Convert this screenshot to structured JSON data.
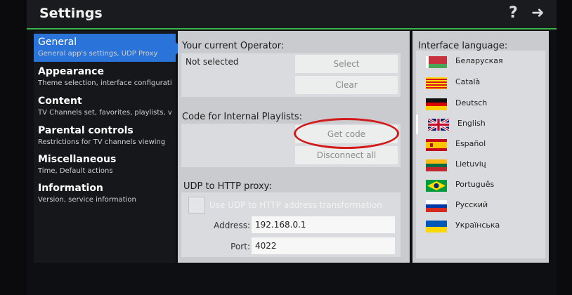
{
  "header": {
    "title": "Settings",
    "help_icon": "?",
    "forward_icon": "➜"
  },
  "sidebar": {
    "items": [
      {
        "label": "General",
        "sub": "General app's settings, UDP Proxy"
      },
      {
        "label": "Appearance",
        "sub": "Theme selection, interface configuration"
      },
      {
        "label": "Content",
        "sub": "TV Channels set, favorites, playlists, video"
      },
      {
        "label": "Parental controls",
        "sub": "Restrictions for TV channels viewing"
      },
      {
        "label": "Miscellaneous",
        "sub": "Time, Default actions"
      },
      {
        "label": "Information",
        "sub": "Version, service information"
      }
    ]
  },
  "operator": {
    "title": "Your current Operator:",
    "value": "Not selected",
    "select_label": "Select",
    "clear_label": "Clear"
  },
  "playlists": {
    "title": "Code for Internal Playlists:",
    "get_code_label": "Get code",
    "disconnect_label": "Disconnect all"
  },
  "proxy": {
    "title": "UDP to HTTP proxy:",
    "checkbox_label": "Use UDP to HTTP address transformation",
    "address_label": "Address:",
    "address_value": "192.168.0.1",
    "port_label": "Port:",
    "port_value": "4022"
  },
  "language": {
    "title": "Interface language:",
    "items": [
      {
        "name": "Беларуская"
      },
      {
        "name": "Català"
      },
      {
        "name": "Deutsch"
      },
      {
        "name": "English"
      },
      {
        "name": "Español"
      },
      {
        "name": "Lietuvių"
      },
      {
        "name": "Português"
      },
      {
        "name": "Русский"
      },
      {
        "name": "Українська"
      }
    ]
  }
}
